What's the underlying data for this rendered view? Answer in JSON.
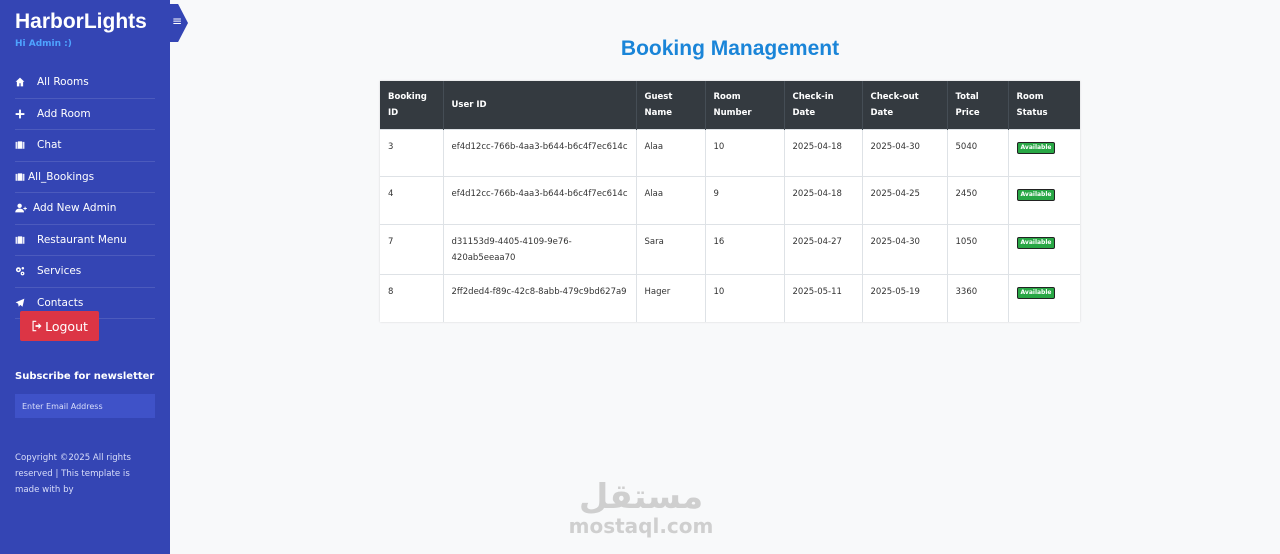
{
  "sidebar": {
    "brand": "HarborLights",
    "greeting": "Hi Admin :)",
    "items": [
      {
        "label": "All Rooms",
        "icon": "home-icon"
      },
      {
        "label": "Add Room",
        "icon": "plus-icon"
      },
      {
        "label": "Chat",
        "icon": "briefcase-icon"
      },
      {
        "label": "All_Bookings",
        "icon": "briefcase-icon"
      },
      {
        "label": "Add New Admin",
        "icon": "user-plus-icon"
      },
      {
        "label": "Restaurant Menu",
        "icon": "briefcase-icon"
      },
      {
        "label": "Services",
        "icon": "gears-icon"
      },
      {
        "label": "Contacts",
        "icon": "paper-plane-icon"
      }
    ],
    "logout_label": "Logout",
    "newsletter_title": "Subscribe for newsletter",
    "newsletter_placeholder": "Enter Email Address",
    "copyright": "Copyright ©2025 All rights reserved | This template is made with by"
  },
  "main": {
    "title": "Booking Management",
    "table": {
      "headers": [
        "Booking ID",
        "User ID",
        "Guest Name",
        "Room Number",
        "Check-in Date",
        "Check-out Date",
        "Total Price",
        "Room Status"
      ],
      "rows": [
        {
          "booking_id": "3",
          "user_id": "ef4d12cc-766b-4aa3-b644-b6c4f7ec614c",
          "guest": "Alaa",
          "room": "10",
          "checkin": "2025-04-18",
          "checkout": "2025-04-30",
          "price": "5040",
          "status": "Available"
        },
        {
          "booking_id": "4",
          "user_id": "ef4d12cc-766b-4aa3-b644-b6c4f7ec614c",
          "guest": "Alaa",
          "room": "9",
          "checkin": "2025-04-18",
          "checkout": "2025-04-25",
          "price": "2450",
          "status": "Available"
        },
        {
          "booking_id": "7",
          "user_id": "d31153d9-4405-4109-9e76-420ab5eeaa70",
          "guest": "Sara",
          "room": "16",
          "checkin": "2025-04-27",
          "checkout": "2025-04-30",
          "price": "1050",
          "status": "Available"
        },
        {
          "booking_id": "8",
          "user_id": "2ff2ded4-f89c-42c8-8abb-479c9bd627a9",
          "guest": "Hager",
          "room": "10",
          "checkin": "2025-05-11",
          "checkout": "2025-05-19",
          "price": "3360",
          "status": "Available"
        }
      ]
    }
  },
  "watermark": {
    "arabic": "مستقل",
    "latin": "mostaql.com"
  },
  "colors": {
    "sidebar": "#3445b4",
    "title": "#1a85d8",
    "table_header": "#343a40",
    "badge": "#28a745",
    "logout": "#dc3545",
    "greeting": "#4ea3ff"
  }
}
